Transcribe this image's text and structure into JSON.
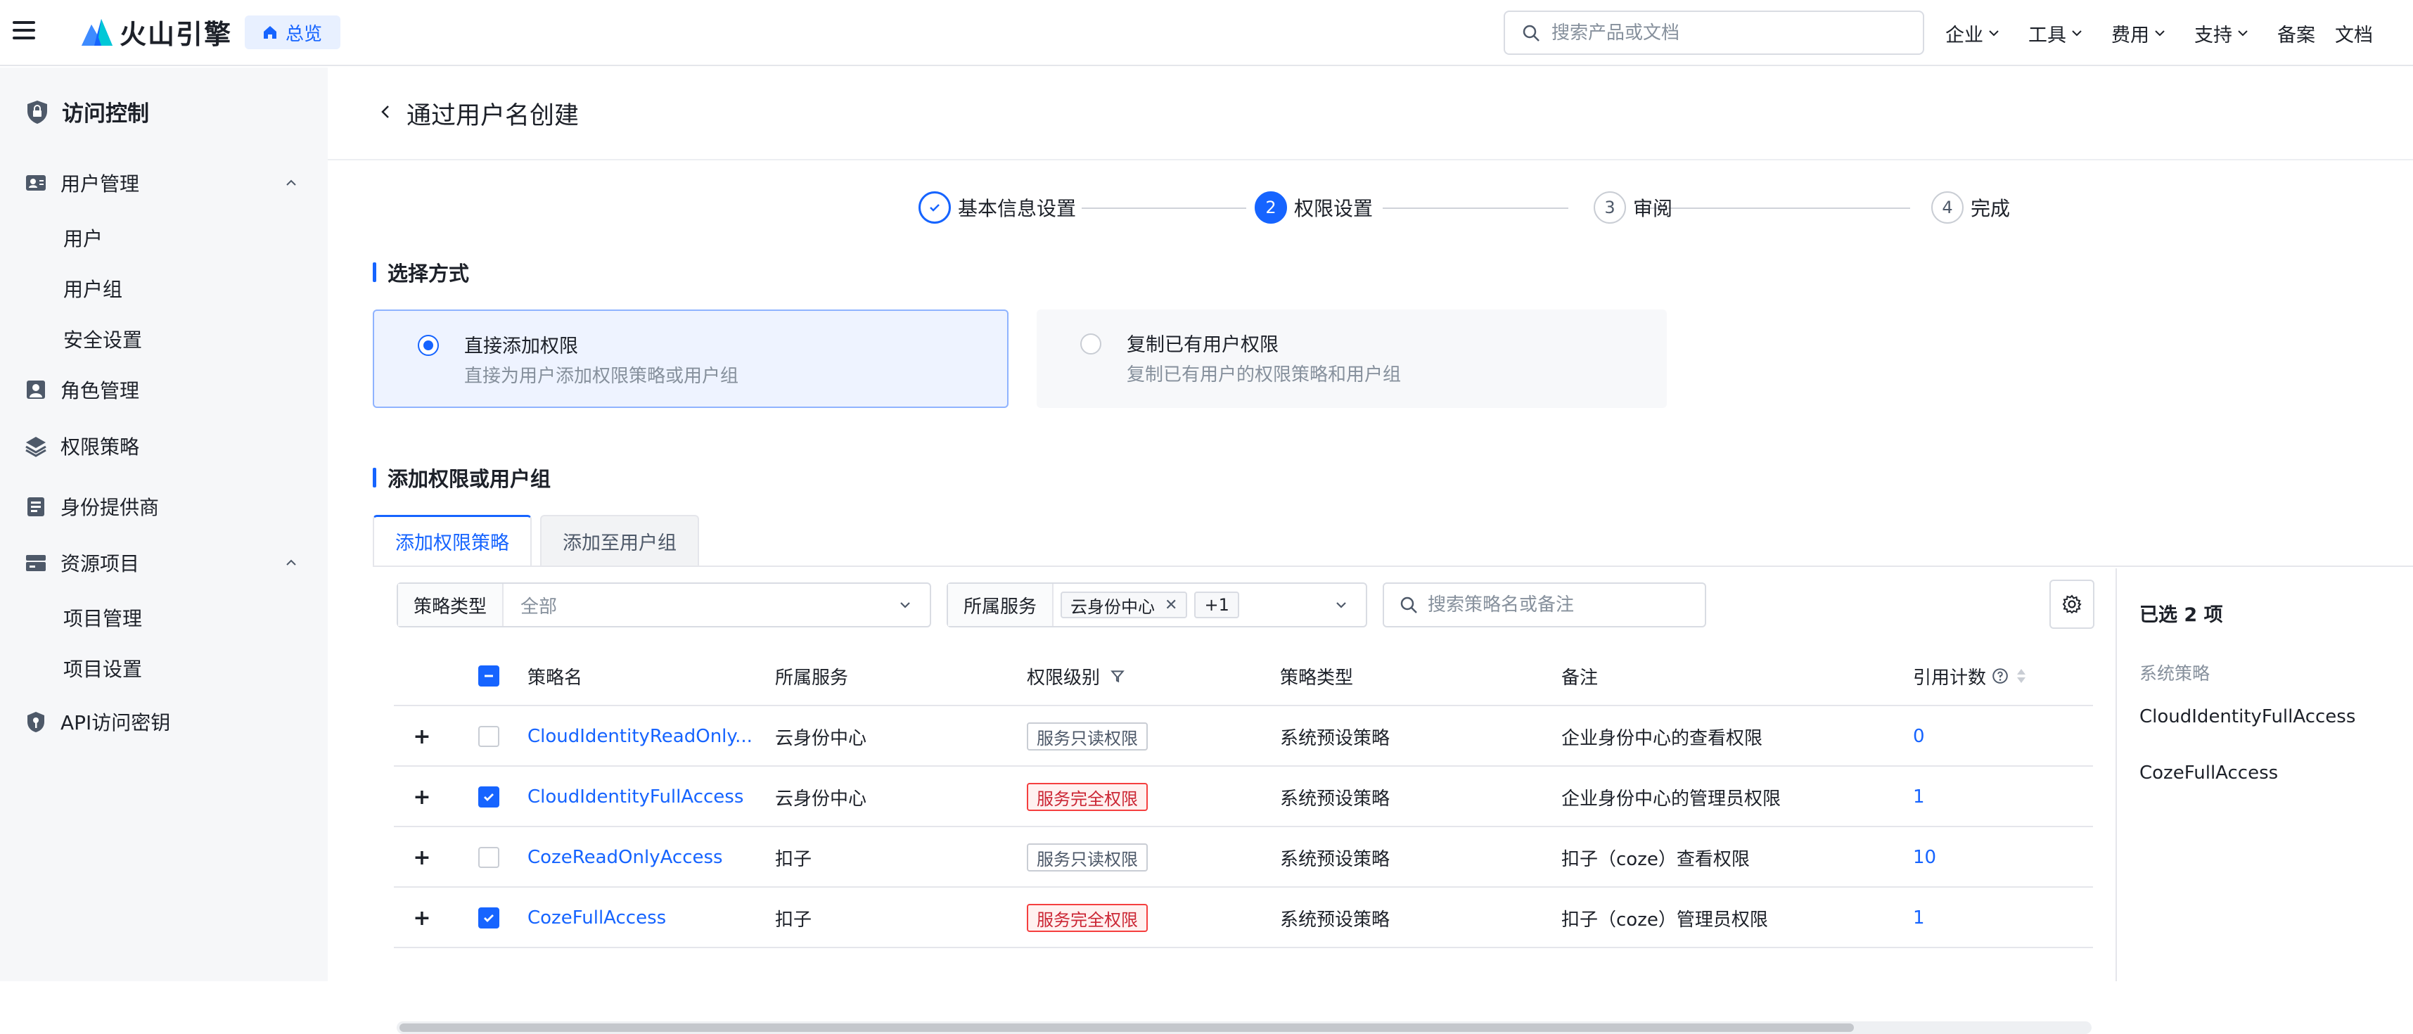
{
  "topbar": {
    "brand": "火山引擎",
    "overview_label": "总览",
    "search_placeholder": "搜索产品或文档",
    "nav": [
      {
        "label": "企业",
        "dropdown": true
      },
      {
        "label": "工具",
        "dropdown": true
      },
      {
        "label": "费用",
        "dropdown": true
      },
      {
        "label": "支持",
        "dropdown": true
      },
      {
        "label": "备案",
        "dropdown": false
      },
      {
        "label": "文档",
        "dropdown": false
      }
    ]
  },
  "sidebar": {
    "title": "访问控制",
    "groups": {
      "users": {
        "label": "用户管理",
        "items": [
          "用户",
          "用户组",
          "安全设置"
        ]
      },
      "roles": {
        "label": "角色管理"
      },
      "policies": {
        "label": "权限策略"
      },
      "idp": {
        "label": "身份提供商"
      },
      "projects": {
        "label": "资源项目",
        "items": [
          "项目管理",
          "项目设置"
        ]
      },
      "apikeys": {
        "label": "API访问密钥"
      }
    }
  },
  "page": {
    "title": "通过用户名创建",
    "steps": [
      {
        "num": "1",
        "label": "基本信息设置",
        "state": "done"
      },
      {
        "num": "2",
        "label": "权限设置",
        "state": "active"
      },
      {
        "num": "3",
        "label": "审阅",
        "state": "pending"
      },
      {
        "num": "4",
        "label": "完成",
        "state": "pending"
      }
    ],
    "method_section_title": "选择方式",
    "methods": [
      {
        "title": "直接添加权限",
        "desc": "直接为用户添加权限策略或用户组",
        "selected": true
      },
      {
        "title": "复制已有用户权限",
        "desc": "复制已有用户的权限策略和用户组",
        "selected": false
      }
    ],
    "add_section_title": "添加权限或用户组",
    "tabs": [
      {
        "label": "添加权限策略",
        "active": true
      },
      {
        "label": "添加至用户组",
        "active": false
      }
    ],
    "filters": {
      "policy_type_label": "策略类型",
      "policy_type_value": "全部",
      "service_label": "所属服务",
      "service_tag": "云身份中心",
      "service_more": "+1",
      "search_placeholder": "搜索策略名或备注"
    },
    "table": {
      "columns": [
        "策略名",
        "所属服务",
        "权限级别",
        "策略类型",
        "备注",
        "引用计数"
      ],
      "rows": [
        {
          "name": "CloudIdentityReadOnly...",
          "service": "云身份中心",
          "level": "服务只读权限",
          "level_type": "read",
          "type": "系统预设策略",
          "note": "企业身份中心的查看权限",
          "count": "0",
          "checked": false
        },
        {
          "name": "CloudIdentityFullAccess",
          "service": "云身份中心",
          "level": "服务完全权限",
          "level_type": "full",
          "type": "系统预设策略",
          "note": "企业身份中心的管理员权限",
          "count": "1",
          "checked": true
        },
        {
          "name": "CozeReadOnlyAccess",
          "service": "扣子",
          "level": "服务只读权限",
          "level_type": "read",
          "type": "系统预设策略",
          "note": "扣子（coze）查看权限",
          "count": "10",
          "checked": false
        },
        {
          "name": "CozeFullAccess",
          "service": "扣子",
          "level": "服务完全权限",
          "level_type": "full",
          "type": "系统预设策略",
          "note": "扣子（coze）管理员权限",
          "count": "1",
          "checked": true
        }
      ]
    },
    "selected_panel": {
      "count_label": "已选 2 项",
      "category": "系统策略",
      "items": [
        "CloudIdentityFullAccess",
        "CozeFullAccess"
      ]
    }
  },
  "colors": {
    "accent": "#1664ff",
    "danger": "#f53f3f",
    "sidebar_bg": "#f6f7f9"
  }
}
